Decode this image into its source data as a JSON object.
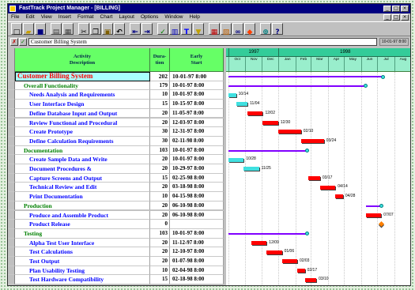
{
  "window": {
    "title": "FastTrack Project Manager - [BILLING]"
  },
  "menu": [
    "File",
    "Edit",
    "View",
    "Insert",
    "Format",
    "Chart",
    "Layout",
    "Options",
    "Window",
    "Help"
  ],
  "toolbar": {
    "groups": [
      [
        "new-file-icon",
        "open-folder-icon",
        "save-disk-icon"
      ],
      [
        "print-icon",
        "print-preview-icon"
      ],
      [
        "cut-icon",
        "copy-icon",
        "paste-icon",
        "undo-icon"
      ],
      [
        "outdent-icon",
        "indent-icon"
      ],
      [
        "checkmark-icon",
        "chart-bars-icon",
        "text-format-icon",
        "filter-funnel-icon"
      ],
      [
        "table-grid-icon",
        "calendar-icon",
        "link-icon",
        "palette-icon"
      ],
      [
        "zoom-icon",
        "help-icon"
      ]
    ]
  },
  "entry": {
    "value": "Customer Billing System",
    "cell_info": "10-01-97 8:00"
  },
  "columns": {
    "activity": [
      "Activity",
      "Description"
    ],
    "duration": [
      "Dura-",
      "tion"
    ],
    "early_start": [
      "Early",
      "Start"
    ]
  },
  "timeline": {
    "years": [
      "1997",
      "1998"
    ],
    "months": [
      "Oct",
      "Nov",
      "Dec",
      "Jan",
      "Feb",
      "Mar",
      "Apr",
      "May",
      "Jun",
      "Jul",
      "Aug"
    ]
  },
  "colors": {
    "task": "#ff0000",
    "summary": "#8000ff",
    "complete": "#40e0e0",
    "milestone": "#ff8000",
    "header": "#66ff66"
  },
  "rows": [
    {
      "name": "Customer Billing System",
      "level": 0,
      "type": "summary",
      "duration": 202,
      "start": "10-01-97 8:00"
    },
    {
      "name": "Overall Functionality",
      "level": 1,
      "type": "summary",
      "duration": 179,
      "start": "10-01-97 8:00"
    },
    {
      "name": "Needs Analysis and Requirements",
      "level": 2,
      "type": "task",
      "duration": 10,
      "start": "10-01-97 8:00",
      "complete": 1,
      "label": "10/14"
    },
    {
      "name": "User Interface Design",
      "level": 2,
      "type": "task",
      "duration": 15,
      "start": "10-15-97 8:00",
      "complete": 1,
      "label": "11/04"
    },
    {
      "name": "Define Database Input and Output",
      "level": 2,
      "type": "task",
      "duration": 20,
      "start": "11-05-97 8:00",
      "complete": 0,
      "label": "12/02"
    },
    {
      "name": "Review Functional and Procedural",
      "level": 2,
      "type": "task",
      "duration": 20,
      "start": "12-03-97 8:00",
      "complete": 0,
      "label": "12/30"
    },
    {
      "name": "Create Prototype",
      "level": 2,
      "type": "task",
      "duration": 30,
      "start": "12-31-97 8:00",
      "complete": 0,
      "label": "02/10"
    },
    {
      "name": "Define Calculation Requirements",
      "level": 2,
      "type": "task",
      "duration": 30,
      "start": "02-11-98 8:00",
      "complete": 0,
      "label": "03/24"
    },
    {
      "name": "Documentation",
      "level": 1,
      "type": "summary",
      "duration": 103,
      "start": "10-01-97 8:00"
    },
    {
      "name": "Create Sample Data and Write",
      "level": 2,
      "type": "task",
      "duration": 20,
      "start": "10-01-97 8:00",
      "complete": 1,
      "label": "10/28"
    },
    {
      "name": "Document Procedures &",
      "level": 2,
      "type": "task",
      "duration": 20,
      "start": "10-29-97 8:00",
      "complete": 1,
      "label": "11/25"
    },
    {
      "name": "Capture Screens and Output",
      "level": 2,
      "type": "task",
      "duration": 15,
      "start": "02-25-98 8:00",
      "complete": 0,
      "label": "03/17"
    },
    {
      "name": "Technical Review and Edit",
      "level": 2,
      "type": "task",
      "duration": 20,
      "start": "03-18-98 8:00",
      "complete": 0,
      "label": "04/14"
    },
    {
      "name": "Print Documentation",
      "level": 2,
      "type": "task",
      "duration": 10,
      "start": "04-15-98 8:00",
      "complete": 0,
      "label": "04/28"
    },
    {
      "name": "Production",
      "level": 1,
      "type": "summary",
      "duration": 20,
      "start": "06-10-98 8:00"
    },
    {
      "name": "Produce and Assemble Product",
      "level": 2,
      "type": "task",
      "duration": 20,
      "start": "06-10-98 8:00",
      "complete": 0,
      "label": "07/07"
    },
    {
      "name": "Product Release",
      "level": 2,
      "type": "milestone",
      "duration": 0,
      "start": ""
    },
    {
      "name": "Testing",
      "level": 1,
      "type": "summary",
      "duration": 103,
      "start": "10-01-97 8:00"
    },
    {
      "name": "Alpha Test User Interface",
      "level": 2,
      "type": "task",
      "duration": 20,
      "start": "11-12-97 8:00",
      "complete": 0,
      "label": "12/09"
    },
    {
      "name": "Test Calculations",
      "level": 2,
      "type": "task",
      "duration": 20,
      "start": "12-10-97 8:00",
      "complete": 0,
      "label": "01/06"
    },
    {
      "name": "Test Output",
      "level": 2,
      "type": "task",
      "duration": 20,
      "start": "01-07-98 8:00",
      "complete": 0,
      "label": "02/03"
    },
    {
      "name": "Plan Usability Testing",
      "level": 2,
      "type": "task",
      "duration": 10,
      "start": "02-04-98 8:00",
      "complete": 0,
      "label": "02/17"
    },
    {
      "name": "Test Hardware Compatibility",
      "level": 2,
      "type": "task",
      "duration": 15,
      "start": "02-18-98 8:00",
      "complete": 0,
      "label": "03/10"
    }
  ]
}
